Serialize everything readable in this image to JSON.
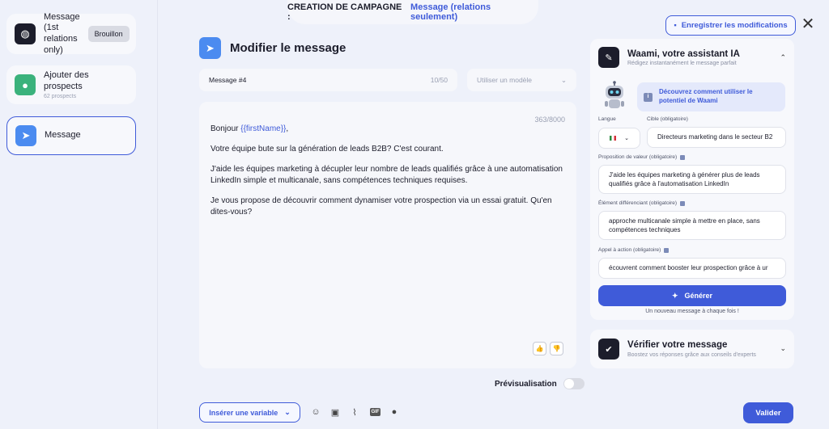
{
  "campaign": {
    "label": "CREATION DE CAMPAGNE :",
    "value": "Message (relations seulement)"
  },
  "save_button": "Enregistrer les modifications",
  "close_symbol": "✕",
  "sidebar": {
    "steps": [
      {
        "title": "Message (1st relations only)",
        "badge": "Brouillon",
        "icon": "planet-icon"
      },
      {
        "title": "Ajouter des prospects",
        "sub": "62 prospects",
        "icon": "user-add-icon"
      },
      {
        "title": "Message",
        "icon": "send-icon"
      }
    ]
  },
  "editor": {
    "title": "Modifier le message",
    "message_name": "Message #4",
    "name_count": "10/50",
    "template_placeholder": "Utiliser un modèle",
    "char_count": "363/8000",
    "greeting": "Bonjour ",
    "variable": "{{firstName}}",
    "greeting_end": ",",
    "paragraphs": [
      "Votre équipe bute sur la génération de leads B2B? C'est courant.",
      "J'aide les équipes marketing à décupler leur nombre de leads qualifiés grâce à une automatisation LinkedIn simple et multicanale, sans compétences techniques requises.",
      "Je vous propose de découvrir comment dynamiser votre prospection via un essai gratuit. Qu'en dites-vous?"
    ],
    "preview_label": "Prévisualisation",
    "insert_variable": "Insérer une variable",
    "validate": "Valider"
  },
  "assistant": {
    "title": "Waami, votre assistant IA",
    "subtitle": "Rédigez instantanément le message parfait",
    "discover": "Découvrez comment utiliser le potentiel de Waami",
    "lang_label": "Langue",
    "target_label": "Cible (obligatoire)",
    "target_value": "Directeurs marketing dans le secteur B2",
    "value_label": "Proposition de valeur (obligatoire)",
    "value_value": "J'aide les équipes marketing à générer plus de leads qualifiés grâce à l'automatisation LinkedIn",
    "diff_label": "Élément différenciant (obligatoire)",
    "diff_value": "approche multicanale simple à mettre en place, sans compétences techniques",
    "cta_label": "Appel à action (obligatoire)",
    "cta_value": "écouvrent comment booster leur prospection grâce à ur",
    "generate": "Générer",
    "generate_note": "Un nouveau message à chaque fois !"
  },
  "verify": {
    "title": "Vérifier votre message",
    "subtitle": "Boostez vos réponses grâce aux conseils d'experts"
  },
  "colors": {
    "accent": "#3f5bd9",
    "background": "#eef1fa",
    "panel": "#f7f8fc"
  }
}
